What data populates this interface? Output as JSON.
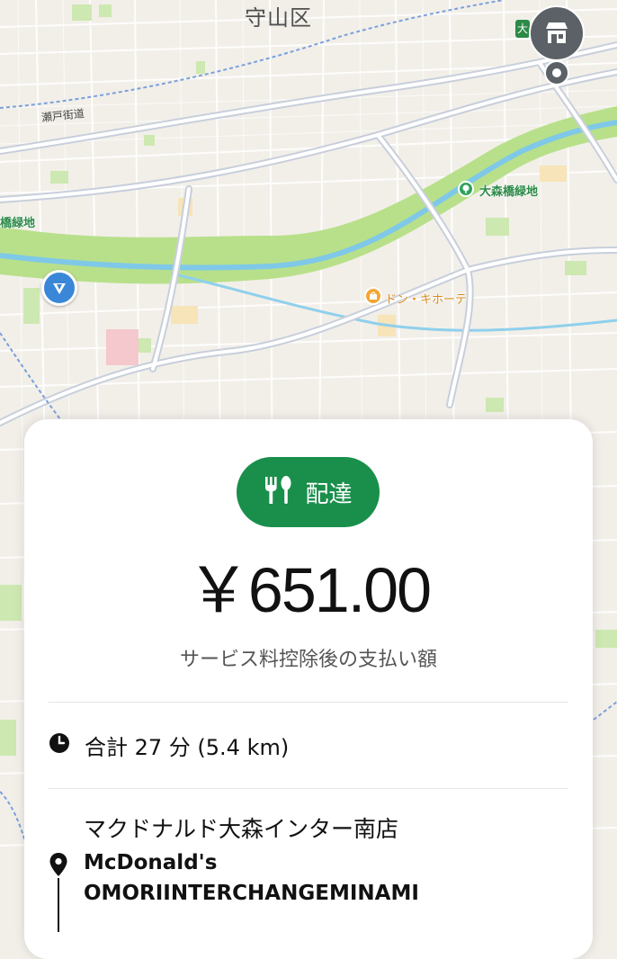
{
  "map": {
    "district_label": "守山区",
    "road_label": "瀬戸街道",
    "park_label": "大森橋緑地",
    "park_label_left": "橋緑地",
    "store_label": "ドン・キホーテ",
    "route_badge": "大"
  },
  "trip": {
    "type_label": "配達",
    "fare": "￥651.00",
    "fare_caption": "サービス料控除後の支払い額",
    "duration": "合計 27 分 (5.4 km)",
    "pickup_name_ja": "マクドナルド大森インター南店",
    "pickup_name_en_1": "McDonald's",
    "pickup_name_en_2": "OMORIINTERCHANGEMINAMI"
  },
  "colors": {
    "accent_green": "#198f4b",
    "marker_gray": "#5b6166",
    "nav_blue": "#3a87d8",
    "river_blue": "#7fc8e8",
    "park_green": "#b8e08a"
  },
  "icons": {
    "type_pill": "fork-knife-icon",
    "duration": "clock-icon",
    "pickup": "location-pin-icon",
    "restaurant_marker": "storefront-icon",
    "current_location": "navigation-arrow-icon"
  }
}
